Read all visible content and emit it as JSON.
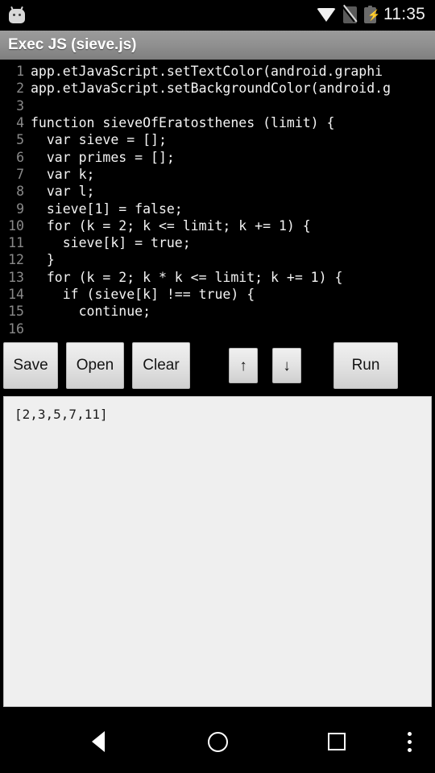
{
  "status_bar": {
    "notification_icon": "android-robot-icon",
    "wifi_icon": "wifi-icon",
    "sim_icon": "no-sim-icon",
    "battery_icon": "battery-charging-icon",
    "time": "11:35"
  },
  "title_bar": {
    "title": "Exec JS (sieve.js)"
  },
  "editor": {
    "lines": [
      {
        "number": "1",
        "text": "app.etJavaScript.setTextColor(android.graphi"
      },
      {
        "number": "2",
        "text": "app.etJavaScript.setBackgroundColor(android.g"
      },
      {
        "number": "3",
        "text": ""
      },
      {
        "number": "4",
        "text": "function sieveOfEratosthenes (limit) {"
      },
      {
        "number": "5",
        "text": "  var sieve = [];"
      },
      {
        "number": "6",
        "text": "  var primes = [];"
      },
      {
        "number": "7",
        "text": "  var k;"
      },
      {
        "number": "8",
        "text": "  var l;"
      },
      {
        "number": "9",
        "text": "  sieve[1] = false;"
      },
      {
        "number": "10",
        "text": "  for (k = 2; k <= limit; k += 1) {"
      },
      {
        "number": "11",
        "text": "    sieve[k] = true;"
      },
      {
        "number": "12",
        "text": "  }"
      },
      {
        "number": "13",
        "text": "  for (k = 2; k * k <= limit; k += 1) {"
      },
      {
        "number": "14",
        "text": "    if (sieve[k] !== true) {"
      },
      {
        "number": "15",
        "text": "      continue;"
      },
      {
        "number": "16",
        "text": ""
      }
    ]
  },
  "toolbar": {
    "save_label": "Save",
    "open_label": "Open",
    "clear_label": "Clear",
    "up_label": "↑",
    "down_label": "↓",
    "run_label": "Run"
  },
  "output": {
    "text": "[2,3,5,7,11]"
  },
  "nav_bar": {
    "back_icon": "back-triangle-icon",
    "home_icon": "home-circle-icon",
    "recents_icon": "recents-square-icon",
    "overflow_icon": "overflow-menu-icon"
  }
}
